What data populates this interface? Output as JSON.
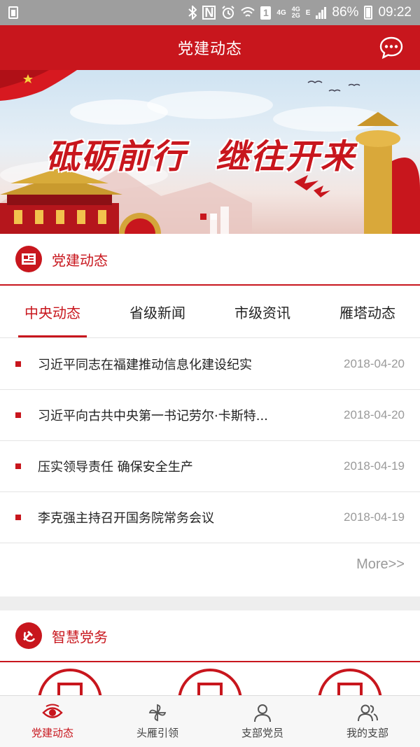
{
  "status_bar": {
    "network_4g": "4G",
    "network_4g_2g_top": "4G",
    "network_4g_2g_bottom": "2G",
    "network_e": "E",
    "battery": "86%",
    "time": "09:22"
  },
  "header": {
    "title": "党建动态"
  },
  "banner": {
    "slogan_left": "砥砺前行",
    "slogan_right": "继往开来",
    "slide_count": 2,
    "active_slide": 1
  },
  "section_news": {
    "title": "党建动态",
    "tabs": [
      {
        "label": "中央动态",
        "active": true
      },
      {
        "label": "省级新闻",
        "active": false
      },
      {
        "label": "市级资讯",
        "active": false
      },
      {
        "label": "雁塔动态",
        "active": false
      }
    ],
    "items": [
      {
        "title": "习近平同志在福建推动信息化建设纪实",
        "date": "2018-04-20"
      },
      {
        "title": "习近平向古共中央第一书记劳尔·卡斯特...",
        "date": "2018-04-20"
      },
      {
        "title": "压实领导责任 确保安全生产",
        "date": "2018-04-19"
      },
      {
        "title": "李克强主持召开国务院常务会议",
        "date": "2018-04-19"
      }
    ],
    "more_label": "More>>"
  },
  "section_smart": {
    "title": "智慧党务"
  },
  "bottom_nav": [
    {
      "label": "党建动态",
      "icon": "eye-icon",
      "active": true
    },
    {
      "label": "头雁引领",
      "icon": "pinwheel-icon",
      "active": false
    },
    {
      "label": "支部党员",
      "icon": "person-icon",
      "active": false
    },
    {
      "label": "我的支部",
      "icon": "group-icon",
      "active": false
    }
  ],
  "colors": {
    "brand_red": "#c8161d",
    "status_bar": "#9e9e9e",
    "muted_text": "#9a9a9a"
  }
}
